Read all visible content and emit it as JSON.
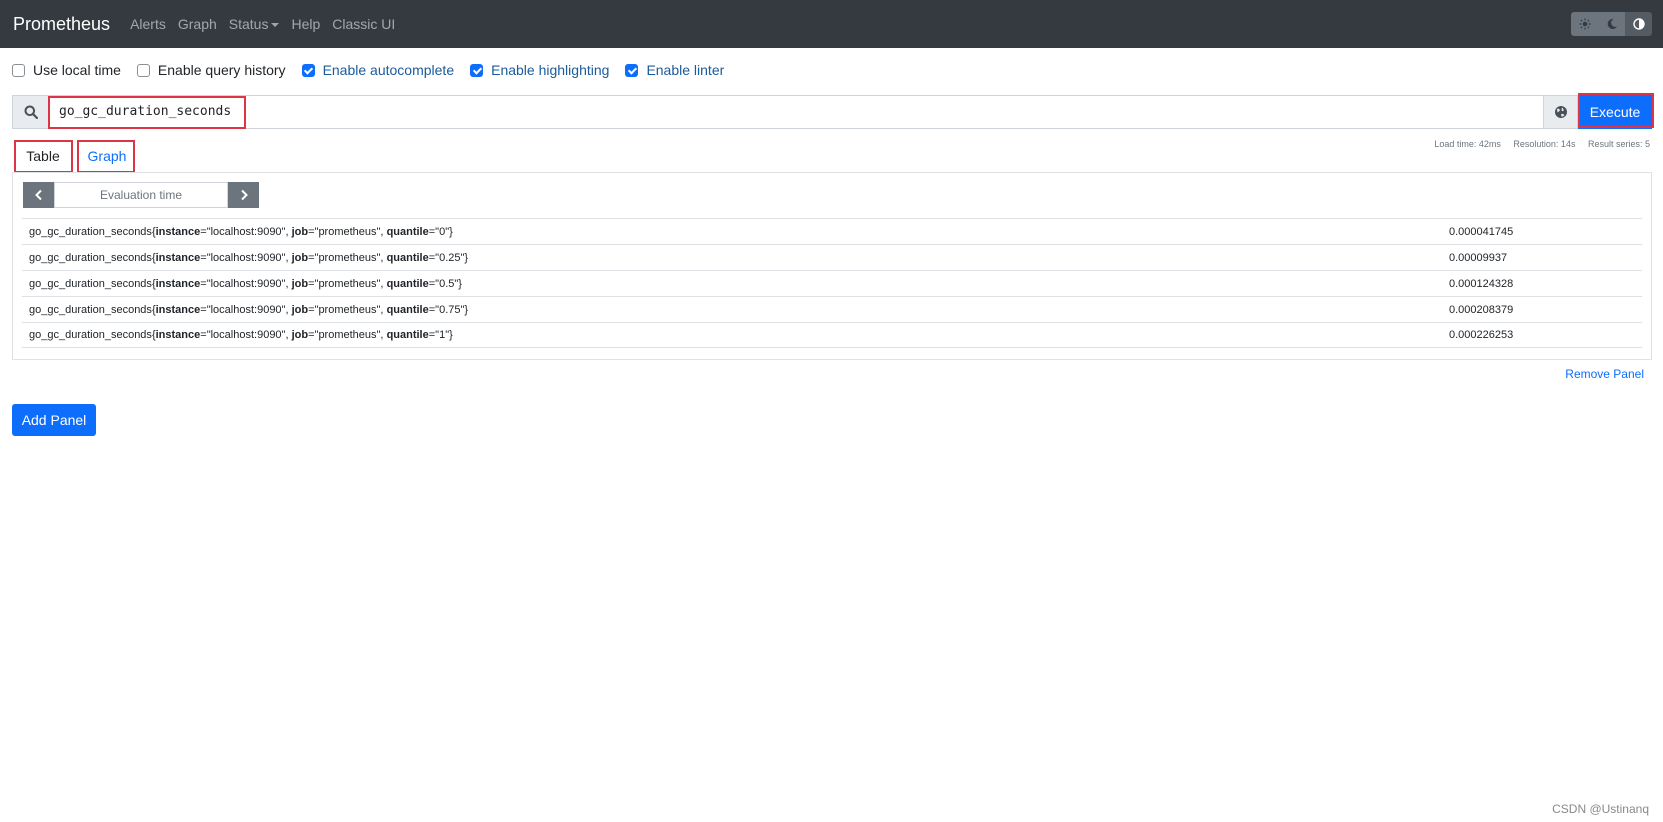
{
  "navbar": {
    "brand": "Prometheus",
    "items": [
      "Alerts",
      "Graph",
      "Status",
      "Help",
      "Classic UI"
    ]
  },
  "options": [
    {
      "label": "Use local time",
      "checked": false
    },
    {
      "label": "Enable query history",
      "checked": false
    },
    {
      "label": "Enable autocomplete",
      "checked": true
    },
    {
      "label": "Enable highlighting",
      "checked": true
    },
    {
      "label": "Enable linter",
      "checked": true
    }
  ],
  "query": {
    "expression": "go_gc_duration_seconds",
    "execute_label": "Execute"
  },
  "tabs": {
    "table": "Table",
    "graph": "Graph"
  },
  "stats": {
    "load_time": "Load time: 42ms",
    "resolution": "Resolution: 14s",
    "result_series": "Result series: 5"
  },
  "eval_time": {
    "placeholder": "Evaluation time"
  },
  "results": [
    {
      "metric": "go_gc_duration_seconds",
      "instance": "localhost:9090",
      "job": "prometheus",
      "quantile": "0",
      "value": "0.000041745"
    },
    {
      "metric": "go_gc_duration_seconds",
      "instance": "localhost:9090",
      "job": "prometheus",
      "quantile": "0.25",
      "value": "0.00009937"
    },
    {
      "metric": "go_gc_duration_seconds",
      "instance": "localhost:9090",
      "job": "prometheus",
      "quantile": "0.5",
      "value": "0.000124328"
    },
    {
      "metric": "go_gc_duration_seconds",
      "instance": "localhost:9090",
      "job": "prometheus",
      "quantile": "0.75",
      "value": "0.000208379"
    },
    {
      "metric": "go_gc_duration_seconds",
      "instance": "localhost:9090",
      "job": "prometheus",
      "quantile": "1",
      "value": "0.000226253"
    }
  ],
  "remove_panel": "Remove Panel",
  "add_panel": "Add Panel",
  "watermark": "CSDN @Ustinanq",
  "colors": {
    "navbar": "#343a40",
    "primary": "#0d6efd",
    "highlight": "#dc3545"
  }
}
